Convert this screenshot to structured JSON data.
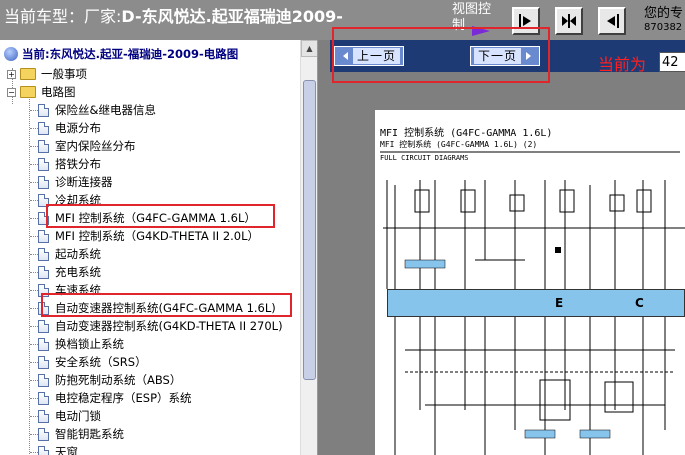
{
  "header": {
    "title_prefix": "当前车型：厂家:",
    "title_bold": "D-东风悦达.起亚福瑞迪2009-",
    "view_control_label": "视图控制",
    "user_text": "您的专",
    "user_id": "870382"
  },
  "tree": {
    "root_label": "当前:东风悦达.起亚-福瑞迪-2009-电路图",
    "folders": [
      {
        "label": "一般事项",
        "expander": "+"
      },
      {
        "label": "电路图",
        "expander": "−"
      }
    ],
    "items": [
      {
        "label": "保险丝&继电器信息"
      },
      {
        "label": "电源分布"
      },
      {
        "label": "室内保险丝分布"
      },
      {
        "label": "搭铁分布"
      },
      {
        "label": "诊断连接器"
      },
      {
        "label": "冷却系统"
      },
      {
        "label": "MFI 控制系统（G4FC-GAMMA 1.6L）"
      },
      {
        "label": "MFI 控制系统（G4KD-THETA II 2.0L）"
      },
      {
        "label": "起动系统"
      },
      {
        "label": "充电系统"
      },
      {
        "label": "车速系统"
      },
      {
        "label": "自动变速器控制系统(G4FC-GAMMA 1.6L)"
      },
      {
        "label": "自动变速器控制系统(G4KD-THETA II 270L)"
      },
      {
        "label": "换档锁止系统"
      },
      {
        "label": "安全系统（SRS）"
      },
      {
        "label": "防抱死制动系统（ABS）"
      },
      {
        "label": "电控稳定程序（ESP）系统"
      },
      {
        "label": "电动门锁"
      },
      {
        "label": "智能钥匙系统"
      },
      {
        "label": "天窗"
      }
    ],
    "scroll_up_glyph": "▲"
  },
  "nav": {
    "prev_label": "上一页",
    "next_label": "下一页",
    "page_label": "当前为",
    "page_value": "42"
  },
  "diagram": {
    "title_line1": "MFI 控制系统 (G4FC-GAMMA 1.6L)",
    "title_line2": "MFI 控制系统 (G4FC-GAMMA 1.6L) (2)",
    "title_line3": "FULL CIRCUIT DIAGRAMS",
    "ecu_label_e": "E",
    "ecu_label_c": "C"
  },
  "colors": {
    "highlight": "#e0262c",
    "nav_bar": "#1e3a74",
    "ecu_fill": "#87c4ec",
    "page_label": "#ff2020"
  }
}
